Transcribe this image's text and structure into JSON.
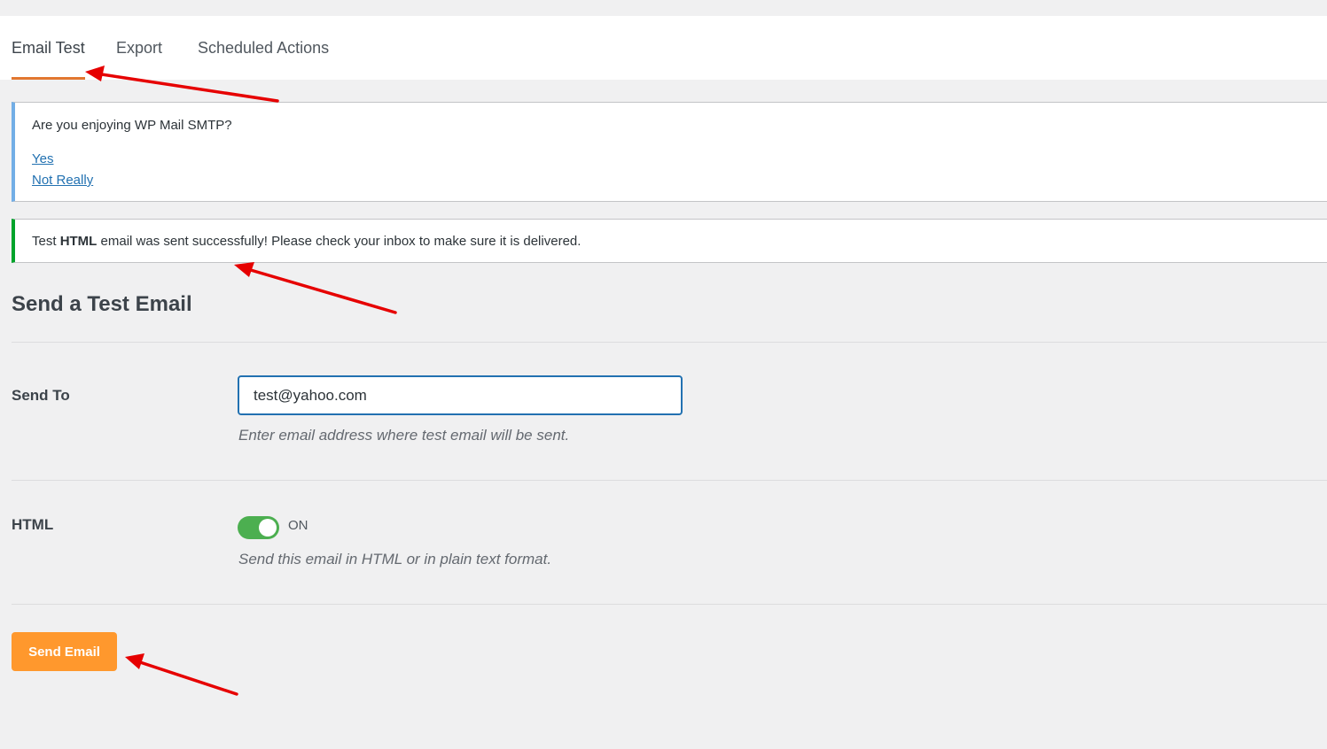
{
  "tabs": [
    {
      "label": "Email Test",
      "active": true
    },
    {
      "label": "Export",
      "active": false
    },
    {
      "label": "Scheduled Actions",
      "active": false
    }
  ],
  "review_notice": {
    "question": "Are you enjoying WP Mail SMTP?",
    "yes_link": "Yes",
    "no_link": "Not Really"
  },
  "success_notice": {
    "prefix": "Test ",
    "bold": "HTML",
    "suffix": " email was sent successfully! Please check your inbox to make sure it is delivered."
  },
  "form": {
    "title": "Send a Test Email",
    "send_to_label": "Send To",
    "send_to_value": "test@yahoo.com",
    "send_to_description": "Enter email address where test email will be sent.",
    "html_label": "HTML",
    "html_toggle_state": "ON",
    "html_description": "Send this email in HTML or in plain text format.",
    "submit_label": "Send Email"
  },
  "colors": {
    "accent": "#e27730",
    "button": "#ff982d",
    "success": "#00a32a",
    "info": "#72aee6",
    "toggle_on": "#4caf50",
    "annotation_arrow": "#e60000"
  }
}
